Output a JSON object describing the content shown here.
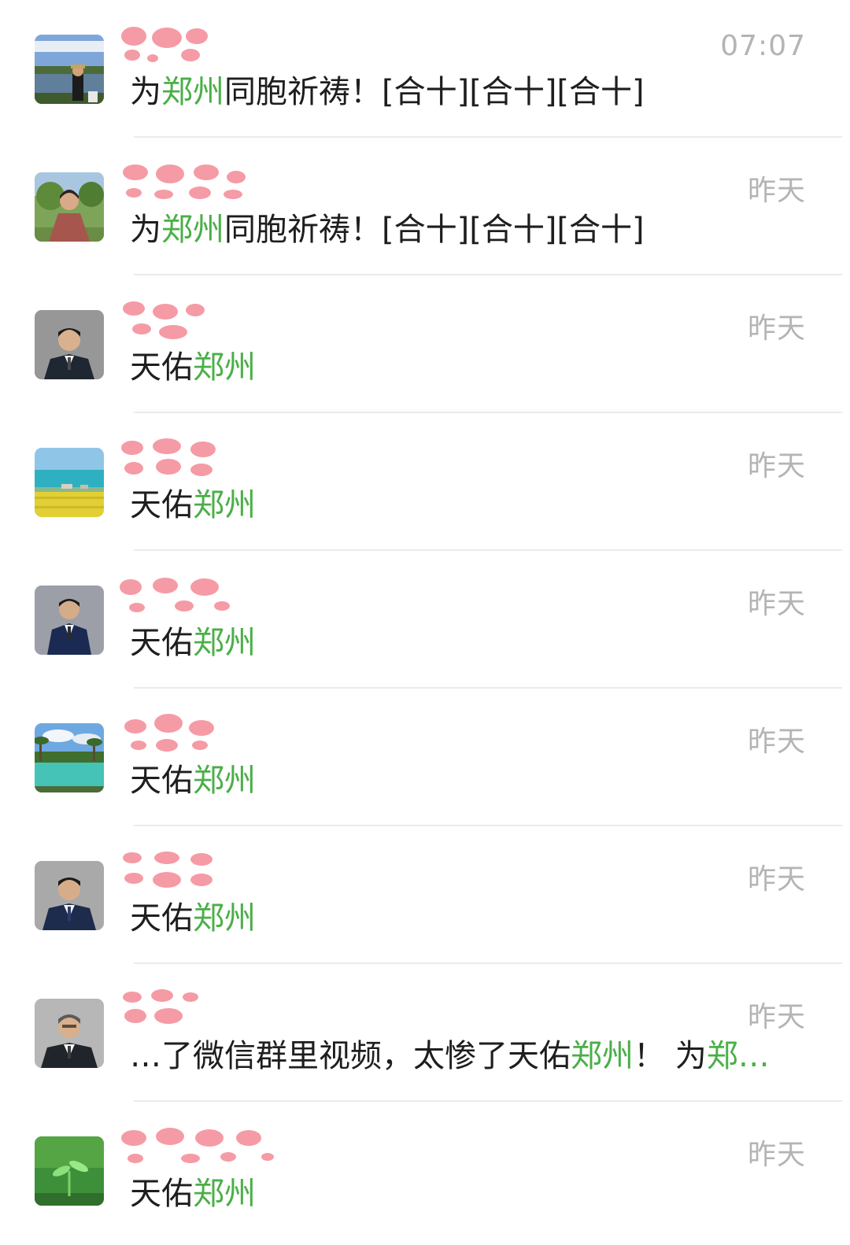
{
  "colors": {
    "highlight": "#4aaf47",
    "time_text": "#b4b4b4",
    "message_text": "#1e1e1e",
    "divider": "#ebebeb",
    "heart": "#f48a96"
  },
  "chats": [
    {
      "avatar_icon": "lake-landscape-person-avatar",
      "name": "",
      "time": "07:07",
      "message_parts": [
        {
          "t": "为",
          "hl": false
        },
        {
          "t": "郑州",
          "hl": true
        },
        {
          "t": "同胞祈祷！[合十][合十][合十]",
          "hl": false
        }
      ]
    },
    {
      "avatar_icon": "woman-outdoor-avatar",
      "name": "",
      "time": "昨天",
      "message_parts": [
        {
          "t": "为",
          "hl": false
        },
        {
          "t": "郑州",
          "hl": true
        },
        {
          "t": "同胞祈祷！[合十][合十][合十]",
          "hl": false
        }
      ]
    },
    {
      "avatar_icon": "man-in-suit-avatar",
      "name": "",
      "time": "昨天",
      "message_parts": [
        {
          "t": "天佑",
          "hl": false
        },
        {
          "t": "郑州",
          "hl": true
        }
      ]
    },
    {
      "avatar_icon": "seaside-field-avatar",
      "name": "",
      "time": "昨天",
      "message_parts": [
        {
          "t": "天佑",
          "hl": false
        },
        {
          "t": "郑州",
          "hl": true
        }
      ]
    },
    {
      "avatar_icon": "man-in-suit-avatar",
      "name": "",
      "time": "昨天",
      "message_parts": [
        {
          "t": "天佑",
          "hl": false
        },
        {
          "t": "郑州",
          "hl": true
        }
      ]
    },
    {
      "avatar_icon": "resort-pool-avatar",
      "name": "",
      "time": "昨天",
      "message_parts": [
        {
          "t": "天佑",
          "hl": false
        },
        {
          "t": "郑州",
          "hl": true
        }
      ]
    },
    {
      "avatar_icon": "man-in-suit-avatar",
      "name": "",
      "time": "昨天",
      "message_parts": [
        {
          "t": "天佑",
          "hl": false
        },
        {
          "t": "郑州",
          "hl": true
        }
      ]
    },
    {
      "avatar_icon": "man-in-suit-avatar",
      "name": "",
      "time": "昨天",
      "message_parts": [
        {
          "t": "…了微信群里视频，太惨了天佑",
          "hl": false
        },
        {
          "t": "郑州",
          "hl": true
        },
        {
          "t": "！ 为",
          "hl": false
        },
        {
          "t": "郑…",
          "hl": true
        }
      ]
    },
    {
      "avatar_icon": "green-sprout-avatar",
      "name": "",
      "time": "昨天",
      "message_parts": [
        {
          "t": "天佑",
          "hl": false
        },
        {
          "t": "郑州",
          "hl": true
        }
      ]
    }
  ]
}
